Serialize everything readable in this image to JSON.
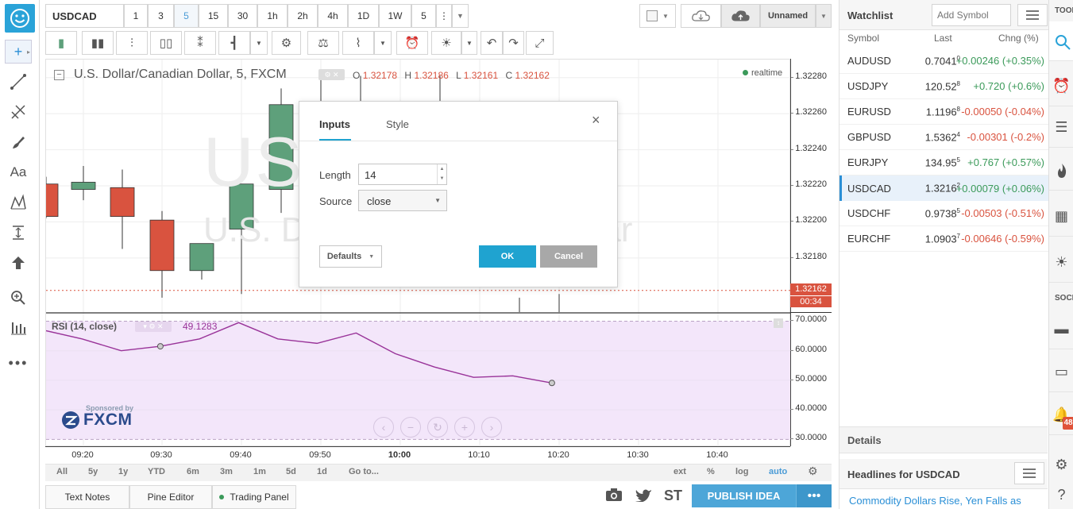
{
  "symbol": "USDCAD",
  "intervals": [
    "1",
    "3",
    "5",
    "15",
    "30",
    "1h",
    "2h",
    "4h",
    "1D",
    "1W",
    "5"
  ],
  "selected_interval": "5",
  "layout_name": "Unnamed",
  "legend": {
    "title": "U.S. Dollar/Canadian Dollar, 5, FXCM",
    "o_label": "O",
    "o": "1.32178",
    "h_label": "H",
    "h": "1.32186",
    "l_label": "L",
    "l": "1.32161",
    "c_label": "C",
    "c": "1.32162",
    "realtime": "realtime"
  },
  "watermark": {
    "line1": "USDCAD, 5",
    "line2": "U.S. Dollar/Canadian Dollar"
  },
  "price_axis": [
    "1.32280",
    "1.32260",
    "1.32240",
    "1.32220",
    "1.32200",
    "1.32180"
  ],
  "price_tag": {
    "value": "1.32162",
    "countdown": "00:34",
    "color": "#d9533f"
  },
  "rsi": {
    "label": "RSI (14, close)",
    "value": "49.1283",
    "axis": [
      "70.0000",
      "60.0000",
      "50.0000",
      "40.0000",
      "30.0000"
    ],
    "points": [
      67.0,
      64.0,
      60.0,
      61.5,
      64.0,
      69.5,
      64.0,
      62.5,
      66.0,
      59.0,
      54.5,
      51.0,
      51.5,
      49.1
    ]
  },
  "candles": [
    {
      "o": 1.32221,
      "h": 1.32225,
      "l": 1.32202,
      "c": 1.32203
    },
    {
      "o": 1.32218,
      "h": 1.32231,
      "l": 1.32212,
      "c": 1.32222
    },
    {
      "o": 1.32219,
      "h": 1.32229,
      "l": 1.32185,
      "c": 1.32203
    },
    {
      "o": 1.32201,
      "h": 1.32206,
      "l": 1.32158,
      "c": 1.32173
    },
    {
      "o": 1.32173,
      "h": 1.32183,
      "l": 1.32168,
      "c": 1.32188
    },
    {
      "o": 1.32196,
      "h": 1.32215,
      "l": 1.3216,
      "c": 1.32221
    },
    {
      "o": 1.32218,
      "h": 1.32274,
      "l": 1.32205,
      "c": 1.32265
    }
  ],
  "time_axis": [
    "09:20",
    "09:30",
    "09:40",
    "09:50",
    "10:00",
    "10:10",
    "10:20",
    "10:30",
    "10:40"
  ],
  "ranges": [
    "All",
    "5y",
    "1y",
    "YTD",
    "6m",
    "3m",
    "1m",
    "5d",
    "1d",
    "Go to..."
  ],
  "axis_opts": [
    "ext",
    "%",
    "log",
    "auto"
  ],
  "bottom_tabs": [
    "Text Notes",
    "Pine Editor",
    "Trading Panel"
  ],
  "publish": "PUBLISH IDEA",
  "sponsor": {
    "small": "Sponsored by",
    "brand": "FXCM"
  },
  "dialog": {
    "tab_inputs": "Inputs",
    "tab_style": "Style",
    "length_label": "Length",
    "length_value": "14",
    "source_label": "Source",
    "source_value": "close",
    "defaults": "Defaults",
    "ok": "OK",
    "cancel": "Cancel",
    "close": "×"
  },
  "watchlist": {
    "title": "Watchlist",
    "add_placeholder": "Add Symbol",
    "col_symbol": "Symbol",
    "col_last": "Last",
    "col_chng": "Chng (%)",
    "rows": [
      {
        "sym": "AUDUSD",
        "last": "0.7041",
        "sup": "0",
        "chg": "+0.00246 (+0.35%)",
        "up": true
      },
      {
        "sym": "USDJPY",
        "last": "120.52",
        "sup": "8",
        "chg": "+0.720 (+0.6%)",
        "up": true
      },
      {
        "sym": "EURUSD",
        "last": "1.1196",
        "sup": "8",
        "chg": "-0.00050 (-0.04%)",
        "up": false
      },
      {
        "sym": "GBPUSD",
        "last": "1.5362",
        "sup": "4",
        "chg": "-0.00301 (-0.2%)",
        "up": false
      },
      {
        "sym": "EURJPY",
        "last": "134.95",
        "sup": "5",
        "chg": "+0.767 (+0.57%)",
        "up": true
      },
      {
        "sym": "USDCAD",
        "last": "1.3216",
        "sup": "2",
        "chg": "+0.00079 (+0.06%)",
        "up": true
      },
      {
        "sym": "USDCHF",
        "last": "0.9738",
        "sup": "5",
        "chg": "-0.00503 (-0.51%)",
        "up": false
      },
      {
        "sym": "EURCHF",
        "last": "1.0903",
        "sup": "7",
        "chg": "-0.00646 (-0.59%)",
        "up": false
      }
    ],
    "selected": "USDCAD",
    "details": "Details",
    "headlines": "Headlines for USDCAD",
    "headline1": "Commodity Dollars Rise, Yen Falls as"
  },
  "right_bar": {
    "tools": "TOOLS",
    "social": "SOCIAL",
    "badge": "48"
  },
  "colors": {
    "up": "#5ea07b",
    "down": "#d9533f",
    "accent": "#1fa3d0",
    "rsi_line": "#993399",
    "rsi_bg": "#f3e6fa"
  }
}
